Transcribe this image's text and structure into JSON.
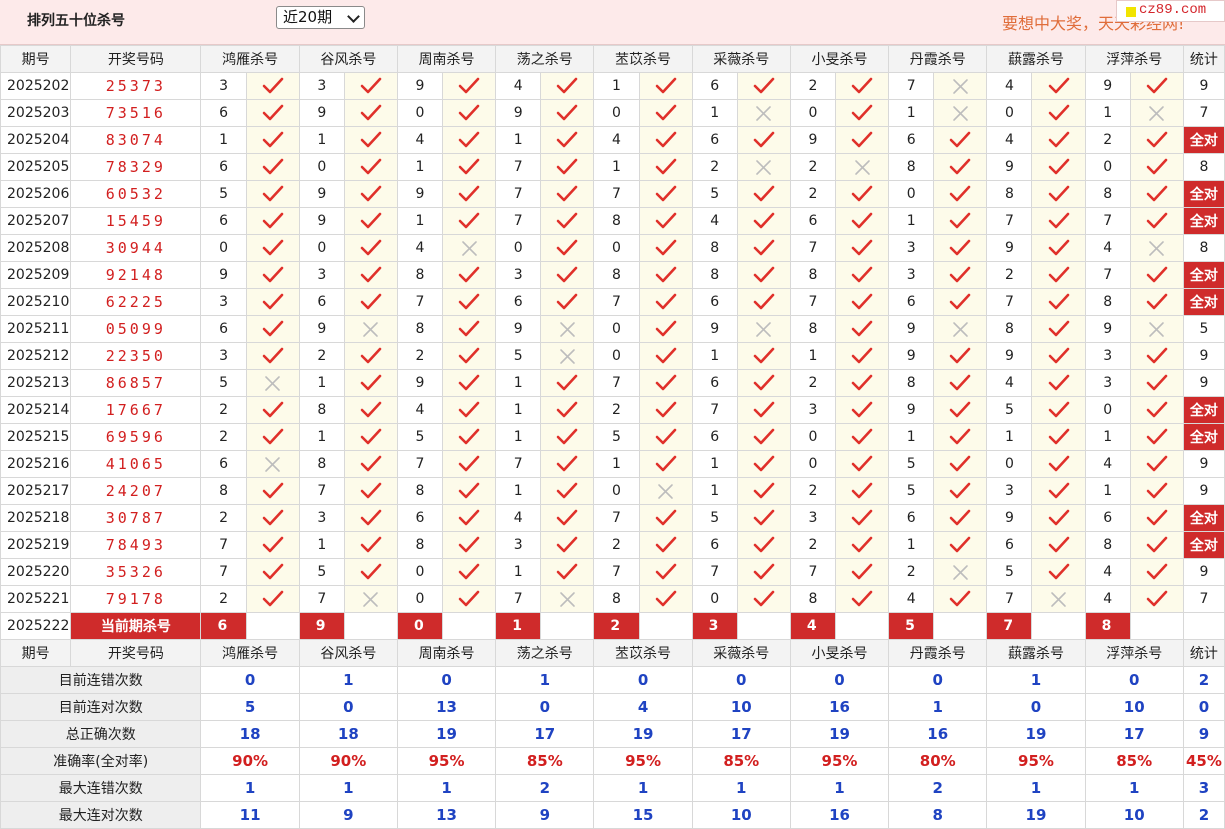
{
  "header": {
    "title": "排列五十位杀号",
    "period_select": "近20期",
    "marquee": "要想中大奖，天天彩经网!",
    "logo_text": "cz89.com"
  },
  "columns": {
    "issue": "期号",
    "draw": "开奖号码",
    "experts": [
      "鸿雁杀号",
      "谷风杀号",
      "周南杀号",
      "荡之杀号",
      "苤苡杀号",
      "采薇杀号",
      "小旻杀号",
      "丹霞杀号",
      "蕻露杀号",
      "浮萍杀号"
    ],
    "stat": "统计"
  },
  "rows": [
    {
      "issue": "2025202",
      "draw": "25373",
      "kills": [
        3,
        3,
        9,
        4,
        1,
        6,
        2,
        7,
        4,
        9
      ],
      "hits": [
        1,
        1,
        1,
        1,
        1,
        1,
        1,
        0,
        1,
        1
      ],
      "stat": "9"
    },
    {
      "issue": "2025203",
      "draw": "73516",
      "kills": [
        6,
        9,
        0,
        9,
        0,
        1,
        0,
        1,
        0,
        1
      ],
      "hits": [
        1,
        1,
        1,
        1,
        1,
        0,
        1,
        0,
        1,
        0
      ],
      "stat": "7"
    },
    {
      "issue": "2025204",
      "draw": "83074",
      "kills": [
        1,
        1,
        4,
        1,
        4,
        6,
        9,
        6,
        4,
        2
      ],
      "hits": [
        1,
        1,
        1,
        1,
        1,
        1,
        1,
        1,
        1,
        1
      ],
      "stat": "全对"
    },
    {
      "issue": "2025205",
      "draw": "78329",
      "kills": [
        6,
        0,
        1,
        7,
        1,
        2,
        2,
        8,
        9,
        0
      ],
      "hits": [
        1,
        1,
        1,
        1,
        1,
        0,
        0,
        1,
        1,
        1
      ],
      "stat": "8"
    },
    {
      "issue": "2025206",
      "draw": "60532",
      "kills": [
        5,
        9,
        9,
        7,
        7,
        5,
        2,
        0,
        8,
        8
      ],
      "hits": [
        1,
        1,
        1,
        1,
        1,
        1,
        1,
        1,
        1,
        1
      ],
      "stat": "全对"
    },
    {
      "issue": "2025207",
      "draw": "15459",
      "kills": [
        6,
        9,
        1,
        7,
        8,
        4,
        6,
        1,
        7,
        7
      ],
      "hits": [
        1,
        1,
        1,
        1,
        1,
        1,
        1,
        1,
        1,
        1
      ],
      "stat": "全对"
    },
    {
      "issue": "2025208",
      "draw": "30944",
      "kills": [
        0,
        0,
        4,
        0,
        0,
        8,
        7,
        3,
        9,
        4
      ],
      "hits": [
        1,
        1,
        0,
        1,
        1,
        1,
        1,
        1,
        1,
        0
      ],
      "stat": "8"
    },
    {
      "issue": "2025209",
      "draw": "92148",
      "kills": [
        9,
        3,
        8,
        3,
        8,
        8,
        8,
        3,
        2,
        7
      ],
      "hits": [
        1,
        1,
        1,
        1,
        1,
        1,
        1,
        1,
        1,
        1
      ],
      "stat": "全对"
    },
    {
      "issue": "2025210",
      "draw": "62225",
      "kills": [
        3,
        6,
        7,
        6,
        7,
        6,
        7,
        6,
        7,
        8
      ],
      "hits": [
        1,
        1,
        1,
        1,
        1,
        1,
        1,
        1,
        1,
        1
      ],
      "stat": "全对"
    },
    {
      "issue": "2025211",
      "draw": "05099",
      "kills": [
        6,
        9,
        8,
        9,
        0,
        9,
        8,
        9,
        8,
        9
      ],
      "hits": [
        1,
        0,
        1,
        0,
        1,
        0,
        1,
        0,
        1,
        0
      ],
      "stat": "5"
    },
    {
      "issue": "2025212",
      "draw": "22350",
      "kills": [
        3,
        2,
        2,
        5,
        0,
        1,
        1,
        9,
        9,
        3
      ],
      "hits": [
        1,
        1,
        1,
        0,
        1,
        1,
        1,
        1,
        1,
        1
      ],
      "stat": "9"
    },
    {
      "issue": "2025213",
      "draw": "86857",
      "kills": [
        5,
        1,
        9,
        1,
        7,
        6,
        2,
        8,
        4,
        3
      ],
      "hits": [
        0,
        1,
        1,
        1,
        1,
        1,
        1,
        1,
        1,
        1
      ],
      "stat": "9"
    },
    {
      "issue": "2025214",
      "draw": "17667",
      "kills": [
        2,
        8,
        4,
        1,
        2,
        7,
        3,
        9,
        5,
        0
      ],
      "hits": [
        1,
        1,
        1,
        1,
        1,
        1,
        1,
        1,
        1,
        1
      ],
      "stat": "全对"
    },
    {
      "issue": "2025215",
      "draw": "69596",
      "kills": [
        2,
        1,
        5,
        1,
        5,
        6,
        0,
        1,
        1,
        1
      ],
      "hits": [
        1,
        1,
        1,
        1,
        1,
        1,
        1,
        1,
        1,
        1
      ],
      "stat": "全对"
    },
    {
      "issue": "2025216",
      "draw": "41065",
      "kills": [
        6,
        8,
        7,
        7,
        1,
        1,
        0,
        5,
        0,
        4
      ],
      "hits": [
        0,
        1,
        1,
        1,
        1,
        1,
        1,
        1,
        1,
        1
      ],
      "stat": "9"
    },
    {
      "issue": "2025217",
      "draw": "24207",
      "kills": [
        8,
        7,
        8,
        1,
        0,
        1,
        2,
        5,
        3,
        1
      ],
      "hits": [
        1,
        1,
        1,
        1,
        0,
        1,
        1,
        1,
        1,
        1
      ],
      "stat": "9"
    },
    {
      "issue": "2025218",
      "draw": "30787",
      "kills": [
        2,
        3,
        6,
        4,
        7,
        5,
        3,
        6,
        9,
        6
      ],
      "hits": [
        1,
        1,
        1,
        1,
        1,
        1,
        1,
        1,
        1,
        1
      ],
      "stat": "全对"
    },
    {
      "issue": "2025219",
      "draw": "78493",
      "kills": [
        7,
        1,
        8,
        3,
        2,
        6,
        2,
        1,
        6,
        8
      ],
      "hits": [
        1,
        1,
        1,
        1,
        1,
        1,
        1,
        1,
        1,
        1
      ],
      "stat": "全对"
    },
    {
      "issue": "2025220",
      "draw": "35326",
      "kills": [
        7,
        5,
        0,
        1,
        7,
        7,
        7,
        2,
        5,
        4
      ],
      "hits": [
        1,
        1,
        1,
        1,
        1,
        1,
        1,
        0,
        1,
        1
      ],
      "stat": "9"
    },
    {
      "issue": "2025221",
      "draw": "79178",
      "kills": [
        2,
        7,
        0,
        7,
        8,
        0,
        8,
        4,
        7,
        4
      ],
      "hits": [
        1,
        0,
        1,
        0,
        1,
        1,
        1,
        1,
        0,
        1
      ],
      "stat": "7"
    }
  ],
  "current": {
    "issue": "2025222",
    "label": "当前期杀号",
    "kills": [
      6,
      9,
      0,
      1,
      2,
      3,
      4,
      5,
      7,
      8
    ]
  },
  "stats": [
    {
      "label": "目前连错次数",
      "values": [
        "0",
        "1",
        "0",
        "1",
        "0",
        "0",
        "0",
        "0",
        "1",
        "0"
      ],
      "total": "2"
    },
    {
      "label": "目前连对次数",
      "values": [
        "5",
        "0",
        "13",
        "0",
        "4",
        "10",
        "16",
        "1",
        "0",
        "10"
      ],
      "total": "0"
    },
    {
      "label": "总正确次数",
      "values": [
        "18",
        "18",
        "19",
        "17",
        "19",
        "17",
        "19",
        "16",
        "19",
        "17"
      ],
      "total": "9"
    },
    {
      "label": "准确率(全对率)",
      "values": [
        "90%",
        "90%",
        "95%",
        "85%",
        "95%",
        "85%",
        "95%",
        "80%",
        "95%",
        "85%"
      ],
      "total": "45%"
    },
    {
      "label": "最大连错次数",
      "values": [
        "1",
        "1",
        "1",
        "2",
        "1",
        "1",
        "1",
        "2",
        "1",
        "1"
      ],
      "total": "3"
    },
    {
      "label": "最大连对次数",
      "values": [
        "11",
        "9",
        "13",
        "9",
        "15",
        "10",
        "16",
        "8",
        "19",
        "10"
      ],
      "total": "2"
    }
  ],
  "colors": {
    "accent": "#cf2b2b",
    "check": "#e0302a",
    "cross": "#bdbdbd",
    "blue": "#1f43c2"
  }
}
